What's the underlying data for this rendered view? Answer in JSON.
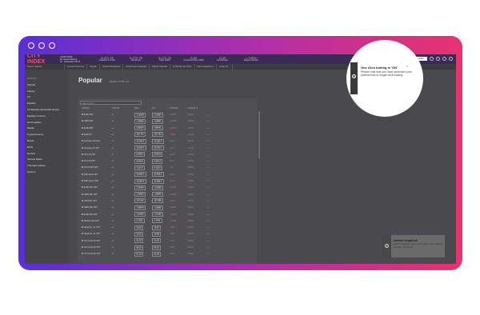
{
  "brand": "CITY INDEX",
  "account": {
    "line1": "CAD8742536",
    "line2": "My Spread Betting",
    "line3": "IG · 22/04/2021 08:15"
  },
  "metrics": [
    {
      "value": "5,272.76",
      "label": "Available to Trade"
    },
    {
      "value": "5,272.76",
      "label": "Net Equity"
    },
    {
      "value": "5,272.76",
      "label": "Cash (GBP)"
    },
    {
      "value": "0.00",
      "label": "Unrealised P&L (GBP)"
    },
    {
      "value": "0.00",
      "label": "Total Margin"
    },
    {
      "value": "> 100%",
      "label": "Margin Indicator"
    }
  ],
  "add_funds": "+ ADD FUNDS",
  "search_placeholder": "Search markets",
  "tabs": [
    "Account Summary",
    "Signals",
    "Outlook Workspace",
    "Performance Analytics",
    "Market Calendar",
    "EUR/USD per IOCC",
    "New workspace 1",
    "Trade Tic..."
  ],
  "sidebar": {
    "header": "MARKETS",
    "items": [
      "Popular",
      "Indices",
      "FX",
      "Equities",
      "US Equities (Extended Hours)",
      "Equities in Focus",
      "Commodities",
      "Metals",
      "Cryptocurrency",
      "Bonds",
      "ETFs",
      "Sectors",
      "Interest Rates",
      "Thematic Indices",
      "Options"
    ]
  },
  "page_title": "Popular",
  "filter_label": "MARKET TYPE: All ▾",
  "filter_placeholder": "Filter markets",
  "table_headers": [
    "MARKET",
    "STATUS",
    "SELL",
    "BUY",
    "CHANGE",
    "CHANGE %"
  ],
  "rows": [
    {
      "name": "EUR/USD",
      "sell": "1.20345",
      "buy": "1.20357",
      "chg": "-0.0011",
      "pct": "-0.09%"
    },
    {
      "name": "GBP/USD",
      "sell": "1.38925",
      "buy": "1.38941",
      "chg": "-0.0035",
      "pct": "-0.25%"
    },
    {
      "name": "EUR/GBP",
      "sell": "0.86624",
      "buy": "0.86641",
      "chg": "-0.0004",
      "pct": "-0.05%"
    },
    {
      "name": "EUR/JPY",
      "sell": "129.761",
      "buy": "129.783",
      "chg": "-0.184",
      "pct": "-0.14%"
    },
    {
      "name": "Germany 40 CFD",
      "sell": "15,290.4",
      "buy": "15,292.4",
      "chg": "-15.6",
      "pct": "-0.10%"
    },
    {
      "name": "Germany 40 SPT",
      "sell": "15,289.9",
      "buy": "15,291.4",
      "chg": "-16.1",
      "pct": "-0.11%"
    },
    {
      "name": "UK 100 CFD",
      "sell": "6,938.9",
      "buy": "6,939.9",
      "chg": "-24.8",
      "pct": "-0.36%"
    },
    {
      "name": "UK 100 SPT",
      "sell": "6,938.6",
      "buy": "6,939.4",
      "chg": "-25.1",
      "pct": "-0.36%"
    },
    {
      "name": "US SP 500 SPT",
      "sell": "4,131.4",
      "buy": "4,132.0",
      "chg": "-3.6",
      "pct": "-0.09%"
    },
    {
      "name": "Wall Street SPT",
      "sell": "33,805.0",
      "buy": "33,808.0",
      "chg": "-16.0",
      "pct": "-0.05%"
    },
    {
      "name": "Wall Street CFD",
      "sell": "33,804.5",
      "buy": "33,808.5",
      "chg": "-16.5",
      "pct": "-0.05%"
    },
    {
      "name": "EUR/USD SPT",
      "sell": "1.20344",
      "buy": "1.20358",
      "chg": "-0.0011",
      "pct": "-0.09%"
    },
    {
      "name": "GBP/USD SPT",
      "sell": "1.38920",
      "buy": "1.38946",
      "chg": "-0.0035",
      "pct": "-0.25%"
    },
    {
      "name": "USD/JPY SPT",
      "sell": "107.843",
      "buy": "107.856",
      "chg": "-0.071",
      "pct": "-0.07%"
    },
    {
      "name": "GBP/USD SPT",
      "sell": "1.38978",
      "buy": "1.38996",
      "chg": "-0.0031",
      "pct": "-0.22%"
    },
    {
      "name": "EUR/USD SPT",
      "sell": "1.20345",
      "buy": "1.20359",
      "chg": "-0.0010",
      "pct": "-0.08%"
    },
    {
      "name": "Natural Gas SPT",
      "sell": "2.7381",
      "buy": "2.7441",
      "chg": "-0.0182",
      "pct": "-0.66%"
    },
    {
      "name": "Sugar No. 11 SPT",
      "sell": "16.92",
      "buy": "16.97",
      "chg": "-0.05",
      "pct": "-0.30%"
    },
    {
      "name": "Sugar No. 11 SPT",
      "sell": "16.91",
      "buy": "16.98",
      "chg": "-0.06",
      "pct": "-0.35%"
    },
    {
      "name": "US Crude Oil SPT",
      "sell": "61.32",
      "buy": "61.35",
      "chg": "-0.42",
      "pct": "-0.68%"
    },
    {
      "name": "UK Crude Oil SPT",
      "sell": "65.19",
      "buy": "65.22",
      "chg": "-0.35",
      "pct": "-0.53%"
    },
    {
      "name": "US Crude Oil SPT",
      "sell": "61.33",
      "buy": "61.36",
      "chg": "-0.41",
      "pct": "-0.66%"
    }
  ],
  "toast": {
    "title": "One click trading is 'ON'",
    "body": "Please note that you have amended your preferences to single-click trading."
  },
  "action": {
    "title": "Action required",
    "body": "Action required: you must confirm your identity to trade real funds."
  },
  "colors": {
    "gradient_start": "#5a2fd6",
    "gradient_end": "#e8336f",
    "brand_red": "#e9587c"
  }
}
